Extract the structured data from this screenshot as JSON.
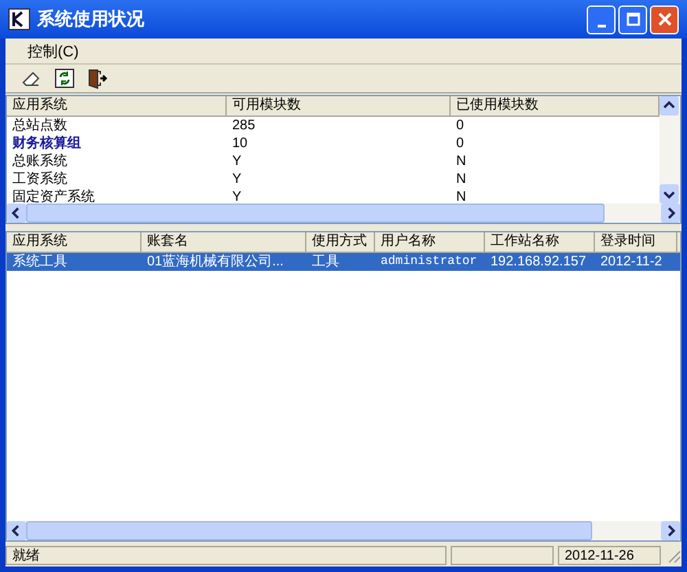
{
  "window": {
    "title": "系统使用状况"
  },
  "menu": [
    {
      "label": "控制(C)"
    }
  ],
  "toolbar": [
    {
      "kind": "eraser"
    },
    {
      "kind": "refresh"
    },
    {
      "kind": "exit"
    }
  ],
  "summary_table": {
    "columns": [
      "应用系统",
      "可用模块数",
      "已使用模块数"
    ],
    "rows": [
      {
        "cells": [
          "总站点数",
          "285",
          "0"
        ],
        "bold": false
      },
      {
        "cells": [
          "财务核算组",
          "10",
          "0"
        ],
        "bold": true
      },
      {
        "cells": [
          "总账系统",
          "Y",
          "N"
        ],
        "bold": false
      },
      {
        "cells": [
          "工资系统",
          "Y",
          "N"
        ],
        "bold": false
      },
      {
        "cells": [
          "固定资产系统",
          "Y",
          "N"
        ],
        "bold": false
      }
    ]
  },
  "session_table": {
    "columns": [
      "应用系统",
      "账套名",
      "使用方式",
      "用户名称",
      "工作站名称",
      "登录时间"
    ],
    "rows": [
      {
        "cells": [
          "系统工具",
          "01蓝海机械有限公司...",
          "工具",
          "administrator",
          "192.168.92.157",
          "2012-11-2"
        ],
        "selected": true
      }
    ]
  },
  "status_bar": {
    "message": "就绪",
    "date": "2012-11-26"
  }
}
